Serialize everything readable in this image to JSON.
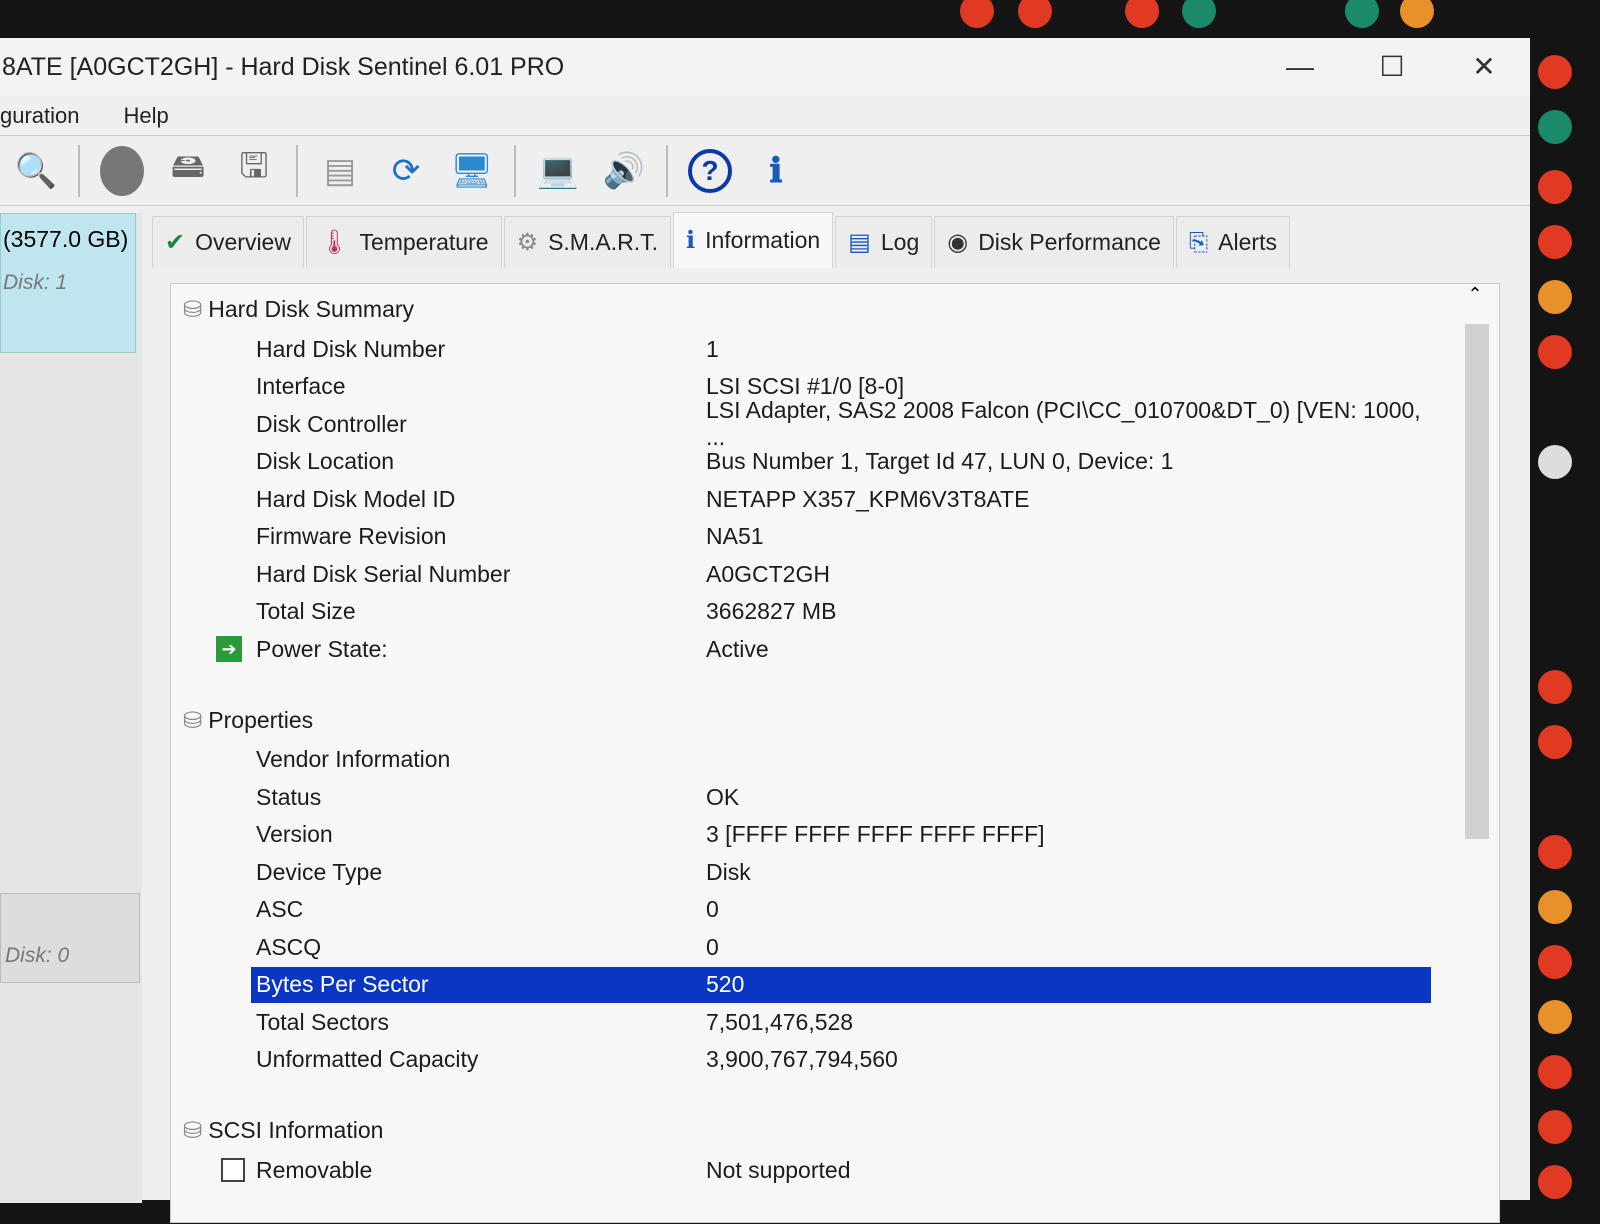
{
  "window": {
    "title": "8ATE [A0GCT2GH]  -  Hard Disk Sentinel 6.01 PRO",
    "minimize": "—",
    "maximize": "☐",
    "close": "✕"
  },
  "menu": [
    "guration",
    "Help"
  ],
  "toolbar": [
    "disk-search-icon",
    "disk-icon",
    "disk-drive-icon",
    "disk-install-icon",
    "report-icon",
    "refresh-icon",
    "network-icon",
    "configuration-icon",
    "sound-icon",
    "help-icon",
    "info-icon"
  ],
  "sidebar": {
    "disk1_size": "(3577.0 GB)",
    "disk1_label": "Disk: 1",
    "disk0_label": "Disk: 0"
  },
  "tabs": [
    {
      "label": "Overview",
      "icon": "✔"
    },
    {
      "label": "Temperature",
      "icon": "🌡"
    },
    {
      "label": "S.M.A.R.T.",
      "icon": "⚙"
    },
    {
      "label": "Information",
      "icon": "ℹ"
    },
    {
      "label": "Log",
      "icon": "▤"
    },
    {
      "label": "Disk Performance",
      "icon": "◉"
    },
    {
      "label": "Alerts",
      "icon": "⎘"
    }
  ],
  "summary": {
    "title": "Hard Disk Summary",
    "rows": [
      {
        "label": "Hard Disk Number",
        "value": "1"
      },
      {
        "label": "Interface",
        "value": "LSI  SCSI #1/0 [8-0]"
      },
      {
        "label": "Disk Controller",
        "value": "LSI Adapter, SAS2 2008 Falcon (PCI\\CC_010700&DT_0) [VEN: 1000, ..."
      },
      {
        "label": "Disk Location",
        "value": "Bus Number 1, Target Id 47, LUN 0, Device: 1"
      },
      {
        "label": "Hard Disk Model ID",
        "value": "NETAPP  X357_KPM6V3T8ATE"
      },
      {
        "label": "Firmware Revision",
        "value": "NA51"
      },
      {
        "label": "Hard Disk Serial Number",
        "value": "A0GCT2GH"
      },
      {
        "label": "Total Size",
        "value": "3662827 MB"
      },
      {
        "label": "Power State:",
        "value": "Active"
      }
    ]
  },
  "properties": {
    "title": "Properties",
    "rows": [
      {
        "label": "Vendor Information",
        "value": ""
      },
      {
        "label": "Status",
        "value": "OK"
      },
      {
        "label": "Version",
        "value": "3 [FFFF FFFF FFFF FFFF FFFF]"
      },
      {
        "label": "Device Type",
        "value": "Disk"
      },
      {
        "label": "ASC",
        "value": "0"
      },
      {
        "label": "ASCQ",
        "value": "0"
      },
      {
        "label": "Bytes Per Sector",
        "value": "520"
      },
      {
        "label": "Total Sectors",
        "value": "7,501,476,528"
      },
      {
        "label": "Unformatted Capacity",
        "value": "3,900,767,794,560"
      }
    ]
  },
  "scsi": {
    "title": "SCSI Information",
    "rows": [
      {
        "label": "Removable",
        "value": "Not supported"
      }
    ]
  },
  "colors": {
    "selection": "#0a36c4"
  }
}
